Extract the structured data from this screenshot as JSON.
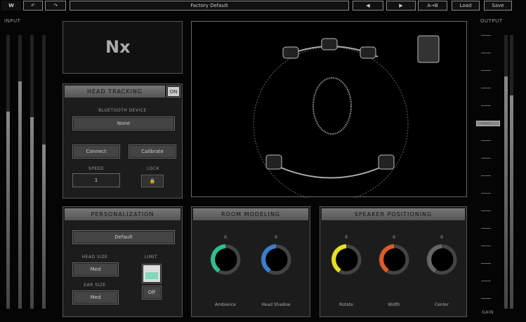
{
  "toolbar": {
    "logo": "W",
    "undo": "↶",
    "redo": "↷",
    "preset": "Factory Default",
    "prev": "◀",
    "next": "▶",
    "ab": "A→B",
    "load": "Load",
    "save": "Save"
  },
  "meters": {
    "input_label": "INPUT",
    "output_label": "OUTPUT",
    "output_gain": "GAIN",
    "input_levels": [
      0.72,
      0.83,
      0.7,
      0.6
    ],
    "output_levels": [
      0.85,
      0.78
    ]
  },
  "logo": "Nx",
  "head_tracking": {
    "title": "HEAD TRACKING",
    "toggle": "ON",
    "device_label": "BLUETOOTH DEVICE",
    "device_value": "None",
    "connect": "Connect",
    "calibrate": "Calibrate",
    "speed_label": "SPEED",
    "speed_value": "1",
    "lock_label": "LOCK",
    "lock_icon": "lock-icon"
  },
  "personalize": {
    "title": "PERSONALIZATION",
    "select_value": "Default",
    "head_label": "HEAD SIZE",
    "head_value": "Med",
    "ear_label": "EAR SIZE",
    "ear_value": "Med",
    "limit_label": "LIMIT",
    "limit_value": "Off"
  },
  "room": {
    "title": "ROOM MODELING",
    "knobs": [
      {
        "label": "Ambience",
        "value": "0",
        "color": "#2fbf8f"
      },
      {
        "label": "Head Shadow",
        "value": "0",
        "color": "#3a7fd0"
      }
    ]
  },
  "speakers": {
    "title": "SPEAKER POSITIONING",
    "knobs": [
      {
        "label": "Rotate",
        "value": "0",
        "color": "#e6e020"
      },
      {
        "label": "Width",
        "value": "0",
        "color": "#e05a2a"
      },
      {
        "label": "Center",
        "value": "0",
        "color": "#666666"
      }
    ]
  }
}
